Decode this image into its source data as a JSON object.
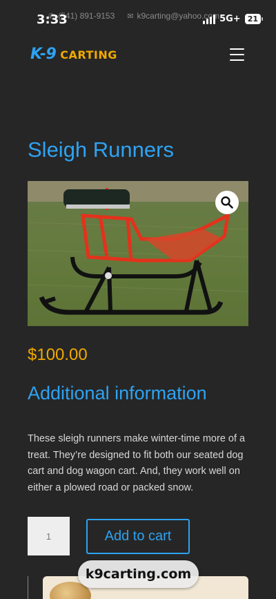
{
  "status_bar": {
    "time": "3:33",
    "network": "5G+",
    "battery": "21"
  },
  "topbar": {
    "phone": "(541) 891-9153",
    "email": "k9carting@yahoo.com"
  },
  "header": {
    "logo_k9": "K-9",
    "logo_carting": "CARTING"
  },
  "product": {
    "title": "Sleigh Runners",
    "price": "$100.00",
    "section_heading": "Additional information",
    "description": "These sleigh runners make winter-time more of a treat. They’re designed to fit both our seated dog cart and dog wagon cart. And, they work well on either a plowed road or packed snow.",
    "quantity": "1",
    "add_to_cart_label": "Add to cart"
  },
  "browser": {
    "url": "k9carting.com"
  },
  "colors": {
    "accent_blue": "#2ea3f2",
    "price_gold": "#f2a900",
    "background": "#262626"
  }
}
